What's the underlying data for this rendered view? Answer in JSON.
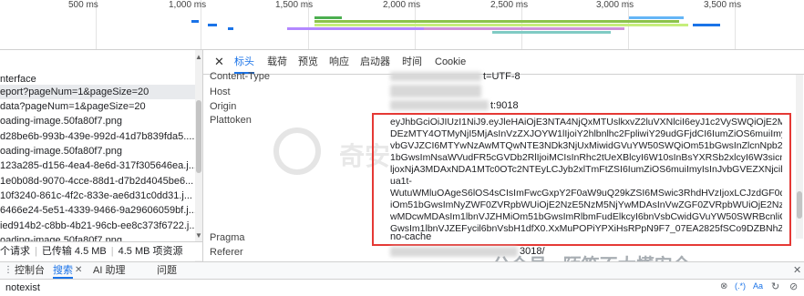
{
  "timeline": {
    "ticks": [
      "500 ms",
      "1,000 ms",
      "1,500 ms",
      "2,000 ms",
      "2,500 ms",
      "3,000 ms",
      "3,500 ms"
    ]
  },
  "requests": [
    "nterface",
    "eport?pageNum=1&pageSize=20",
    "data?pageNum=1&pageSize=20",
    "oading-image.50fa80f7.png",
    "d28be6b-993b-439e-992d-41d7b839fda5....",
    "oading-image.50fa80f7.png",
    "123a285-d156-4ea4-8e6d-317f305646ea.j...",
    "1e0b08d-9070-4cce-88d1-d7b2d4045be6...",
    "10f3240-861c-4f2c-833e-ae6d31c0dd31.j...",
    "6466e24-5e51-4339-9466-9a29606059bf.j...",
    "ied914b2-c8bb-4b21-96cb-ee8c373f6722.j...",
    "oading-image.50fa80f7.png"
  ],
  "status": {
    "count": "个请求",
    "transferred": "已传输 4.5 MB",
    "resources": "4.5 MB 项资源"
  },
  "tabs": [
    "标头",
    "载荷",
    "预览",
    "响应",
    "启动器",
    "时间",
    "Cookie"
  ],
  "headers": {
    "content_type_name": "Content-Type",
    "content_type_value": "t=UTF-8",
    "host_name": "Host",
    "origin_name": "Origin",
    "origin_value": "t:9018",
    "plattoken_name": "Plattoken",
    "pragma_name": "Pragma",
    "pragma_value": "no-cache",
    "referer_name": "Referer",
    "referer_value": "3018/"
  },
  "token_lines": [
    "eyJhbGciOiJIUzI1NiJ9.eyJleHAiOjE3NTA4NjQxMTUslkxvZ2luVXNlciI6eyJ1c2VySWQiOjE2MDcwM",
    "DEzMTY4OTMyNjI5MjAsInVzZXJOYW1lIjoiY2hlbnlhc2FpliwiY29udGFjdCI6IumZiOS6muiImyIsInJ",
    "vbGVJZCI6MTYwNzAwMTQwNTE3NDk3NjUxMiwidGVuYW50SWQiOm51bGwsInZlcnNpb24iOm",
    "1bGwsImNsaWVudFR5cGVDb2RlIjoiMCIsInRhc2tUeXBlcyI6W10sInBsYXRSb2xlcyI6W3sicm9sZUl",
    "ljoxNjA3MDAxNDA1MTc0OTc2NTEyLCJyb2xlTmFtZSI6IumZiOS6muiImyIsInJvbGVEZXNjcil6IuS4i",
    "ua1t-",
    "WutuWMluOAgeS6lOS4sCIsImFwcGxpY2F0aW9uQ29kZSI6MSwic3RhdHVzIjoxLCJzdGF0dXNTdH",
    "iOm51bGwsImNyZWF0ZVRpbWUiOjE2NzE5NzM5NjYwMDAsInVwZGF0ZVRpbWUiOjE2NzczNDI",
    "wMDcwMDAsIm1lbnVJZHMiOm51bGwsImRlbmFudElkcyI6bnVsbCwidGVuYW50SWRBcnliOm51b",
    "GwsIm1lbnVJZEFycil6bnVsbH1dfX0.XxMuPOPiYPXiHsRPpN9F7_07EA2825fSCo9DZBNhZFw"
  ],
  "drawer": {
    "tabs": [
      "控制台",
      "搜索",
      "AI 助理",
      "问题"
    ],
    "search_value": "notexist"
  },
  "watermark": {
    "text": "公众号 · 陌笙不太懂安全",
    "center": "奇安"
  },
  "colors": {
    "accent": "#1a73e8",
    "highlight_border": "#e53935"
  }
}
